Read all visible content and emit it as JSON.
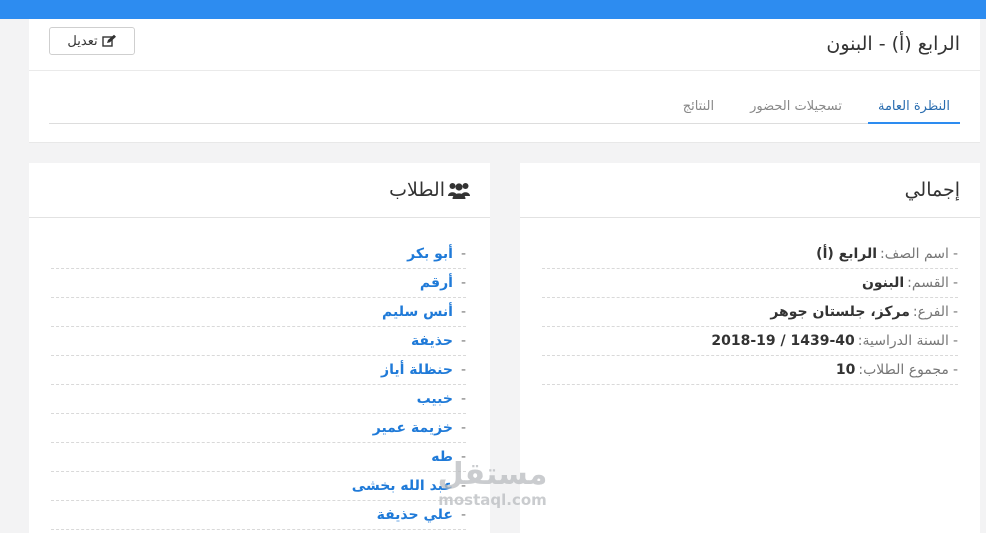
{
  "header": {
    "title": "الرابع (أ) - البنون",
    "edit_label": "تعديل"
  },
  "tabs": [
    {
      "label": "النظرة العامة",
      "active": true
    },
    {
      "label": "تسجيلات الحضور",
      "active": false
    },
    {
      "label": "النتائج",
      "active": false
    }
  ],
  "summary": {
    "title": "إجمالي",
    "rows": [
      {
        "label": "اسم الصف:",
        "value": "الرابع (أ)"
      },
      {
        "label": "القسم:",
        "value": "البنون"
      },
      {
        "label": "الفرع:",
        "value": "مركز، جلستان جوهر"
      },
      {
        "label": "السنة الدراسية:",
        "value": "1439-40 / 2018-19"
      },
      {
        "label": "مجموع الطلاب:",
        "value": "10"
      }
    ]
  },
  "students": {
    "title": "الطلاب",
    "items": [
      "أبو بكر",
      "أرقم",
      "أنس سليم",
      "حذيفة",
      "حنظلة أياز",
      "خبيب",
      "خزيمة عمير",
      "طه",
      "عبد الله بخشى",
      "علي حذيفة"
    ]
  },
  "watermark": {
    "arabic": "مستقل",
    "latin": "mostaql.com"
  },
  "colors": {
    "accent": "#2d8cf0",
    "link": "#1f7ad8"
  }
}
